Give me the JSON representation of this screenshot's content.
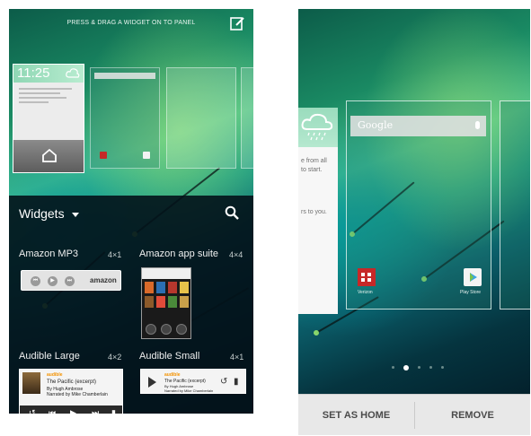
{
  "left_screen": {
    "hint_text": "PRESS & DRAG A WIDGET ON TO PANEL",
    "home_panel": {
      "clock": "11:25"
    },
    "widgets_header": {
      "title": "Widgets"
    },
    "widgets": [
      {
        "name": "Amazon MP3",
        "size": "4×1"
      },
      {
        "name": "Amazon app suite",
        "size": "4×4"
      },
      {
        "name": "Audible Large",
        "size": "4×2"
      },
      {
        "name": "Audible Small",
        "size": "4×1"
      }
    ],
    "amazon_mp3_preview": {
      "logo": "amazon"
    },
    "audible_large_preview": {
      "brand": "audible",
      "title": "The Pacific (excerpt)",
      "author": "By Hugh Ambrose",
      "narrator": "Narrated by Mike Chamberlain"
    },
    "audible_small_preview": {
      "brand": "audible",
      "title": "The Pacific (excerpt)",
      "author": "By Hugh Ambrose",
      "narrator": "Narrated by Mike Chamberlain"
    }
  },
  "right_screen": {
    "left_panel_text": [
      "e from all",
      "to start.",
      "rs to you."
    ],
    "search_placeholder": "Google",
    "apps": [
      {
        "label": "Verizon",
        "icon": "verizon-icon",
        "color": "#c62828"
      },
      {
        "label": "Play Store",
        "icon": "play-store-icon",
        "color": "#f4f4f4"
      }
    ],
    "page_indicator": {
      "count": 5,
      "active_index": 1
    },
    "actions": {
      "set_as_home": "SET AS HOME",
      "remove": "REMOVE"
    }
  }
}
